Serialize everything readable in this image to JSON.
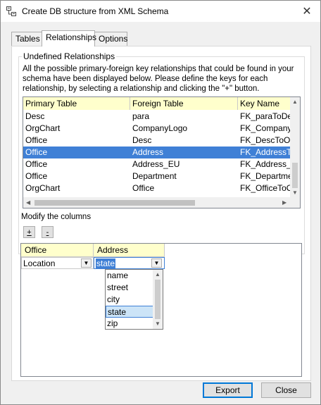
{
  "window": {
    "title": "Create DB structure from XML Schema",
    "close_glyph": "✕"
  },
  "tabs": [
    {
      "label": "Tables"
    },
    {
      "label": "Relationships"
    },
    {
      "label": "Options"
    }
  ],
  "undefined_relationships": {
    "legend": "Undefined Relationships",
    "description": "All the possible primary-foreign key relationships that could be found in your schema have been displayed below. Please define the keys for each relationship, by selecting a relationship and clicking the \"+\" button.",
    "columns": [
      "Primary Table",
      "Foreign Table",
      "Key Name"
    ],
    "rows": [
      {
        "primary": "Desc",
        "foreign": "para",
        "key": "FK_paraToDesc"
      },
      {
        "primary": "OrgChart",
        "foreign": "CompanyLogo",
        "key": "FK_CompanyLogo"
      },
      {
        "primary": "Office",
        "foreign": "Desc",
        "key": "FK_DescToOffice"
      },
      {
        "primary": "Office",
        "foreign": "Address",
        "key": "FK_AddressToOffice",
        "selected": true
      },
      {
        "primary": "Office",
        "foreign": "Address_EU",
        "key": "FK_Address_EU"
      },
      {
        "primary": "Office",
        "foreign": "Department",
        "key": "FK_Department"
      },
      {
        "primary": "OrgChart",
        "foreign": "Office",
        "key": "FK_OfficeToOrgChart"
      }
    ]
  },
  "modify": {
    "label": "Modify the columns",
    "add_label": "+",
    "remove_label": "-"
  },
  "columns_grid": {
    "headers": [
      "Office",
      "Address"
    ],
    "row": {
      "office_value": "Location",
      "address_value": "state"
    },
    "dropdown_options": [
      "name",
      "street",
      "city",
      "state",
      "zip"
    ],
    "dropdown_selected": "state"
  },
  "buttons": {
    "export_label": "Export",
    "close_label": "Close"
  },
  "colors": {
    "header_bg": "#ffffcc",
    "selection": "#3f80d6",
    "accent": "#0078d7"
  }
}
